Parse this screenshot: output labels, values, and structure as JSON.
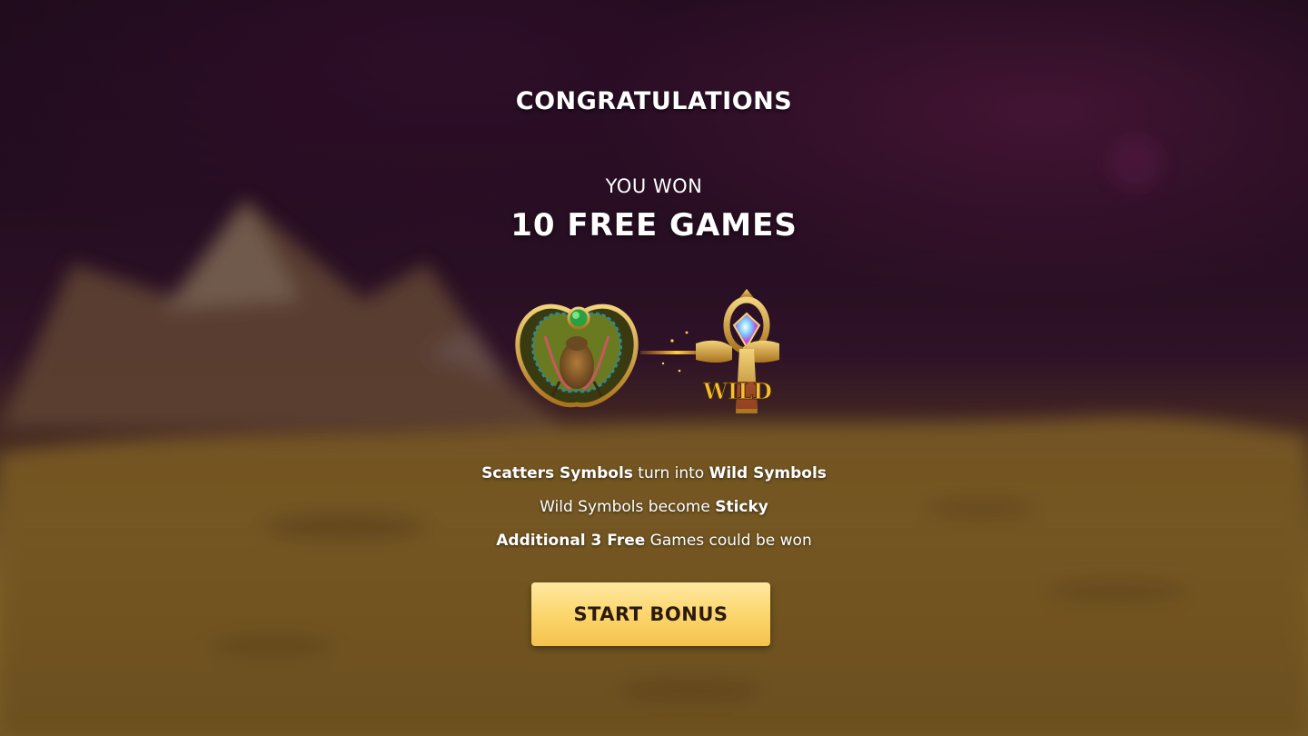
{
  "header": {
    "title": "CONGRATULATIONS",
    "subtitle": "YOU WON",
    "prize": "10 FREE GAMES"
  },
  "symbols": {
    "scatter_icon": "scarab-scatter-icon",
    "wild_icon": "ankh-wild-icon",
    "wild_label": "WILD"
  },
  "features": [
    {
      "b1": "Scatters Symbols",
      "t1": " turn into ",
      "b2": "Wild Symbols",
      "t2": ""
    },
    {
      "b1": "",
      "t1": "Wild Symbols become ",
      "b2": "Sticky",
      "t2": ""
    },
    {
      "b1": "Additional 3 Free",
      "t1": " Games could be won",
      "b2": "",
      "t2": ""
    }
  ],
  "start_button": {
    "label": "START BONUS"
  },
  "colors": {
    "button_top": "#ffe9a0",
    "button_bottom": "#f5c24e",
    "button_text": "#2a1a10",
    "gold": "#d4a437"
  }
}
